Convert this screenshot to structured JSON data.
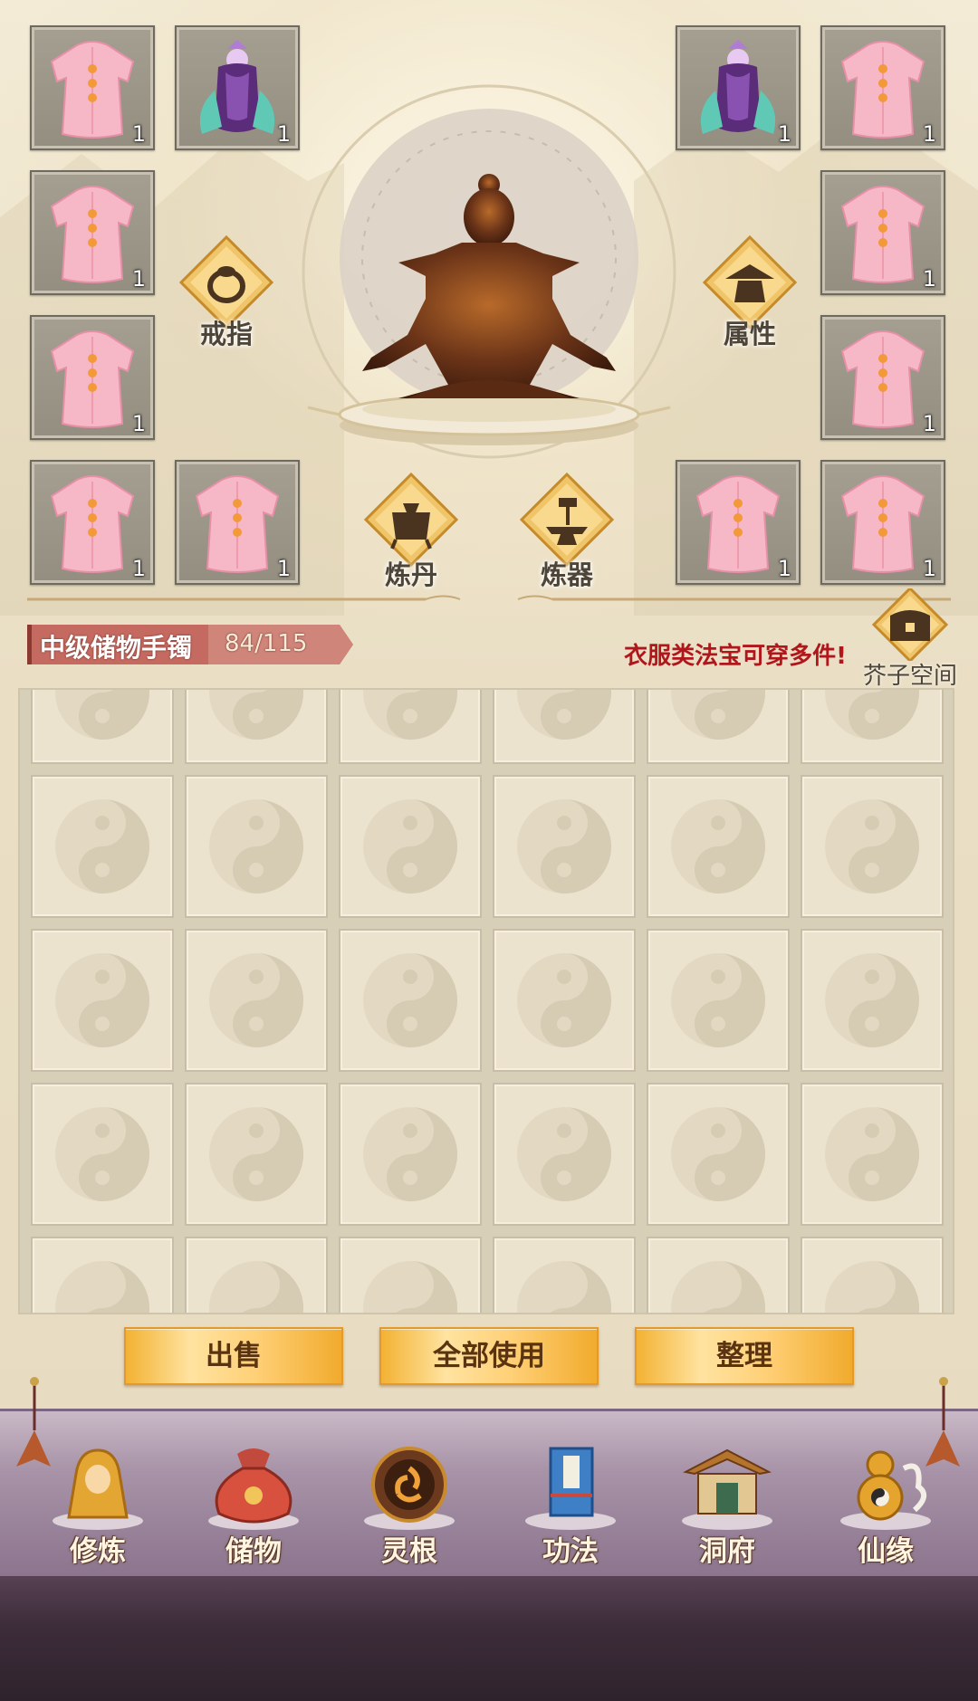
{
  "equipment": {
    "slot_count": "1",
    "slots": [
      {
        "item": "pink-robe",
        "count": "1"
      },
      {
        "item": "purple-fairy-figure",
        "count": "1"
      },
      {
        "item": "purple-fairy-figure",
        "count": "1"
      },
      {
        "item": "pink-robe",
        "count": "1"
      },
      {
        "item": "pink-robe",
        "count": "1"
      },
      {
        "item": "pink-robe",
        "count": "1"
      },
      {
        "item": "pink-robe",
        "count": "1"
      },
      {
        "item": "pink-robe",
        "count": "1"
      },
      {
        "item": "pink-robe",
        "count": "1"
      },
      {
        "item": "pink-robe",
        "count": "1"
      },
      {
        "item": "pink-robe",
        "count": "1"
      },
      {
        "item": "pink-robe",
        "count": "1"
      }
    ],
    "buttons": {
      "ring": "戒指",
      "attributes": "属性",
      "alchemy": "炼丹",
      "forge": "炼器"
    }
  },
  "bag": {
    "name": "中级储物手镯",
    "capacity": "84/115",
    "tip": "衣服类法宝可穿多件!",
    "space_button": "芥子空间"
  },
  "actions": {
    "sell": "出售",
    "use_all": "全部使用",
    "sort": "整理"
  },
  "nav": [
    {
      "label": "修炼",
      "icon": "cultivate-icon"
    },
    {
      "label": "储物",
      "icon": "storage-bag-icon"
    },
    {
      "label": "灵根",
      "icon": "spirit-root-icon"
    },
    {
      "label": "功法",
      "icon": "scripture-book-icon"
    },
    {
      "label": "洞府",
      "icon": "cave-dwelling-icon"
    },
    {
      "label": "仙缘",
      "icon": "gourd-icon"
    }
  ],
  "colors": {
    "accent_gold": "#f3b233",
    "tip_red": "#b0161a",
    "nav_purple": "#8b748d"
  }
}
